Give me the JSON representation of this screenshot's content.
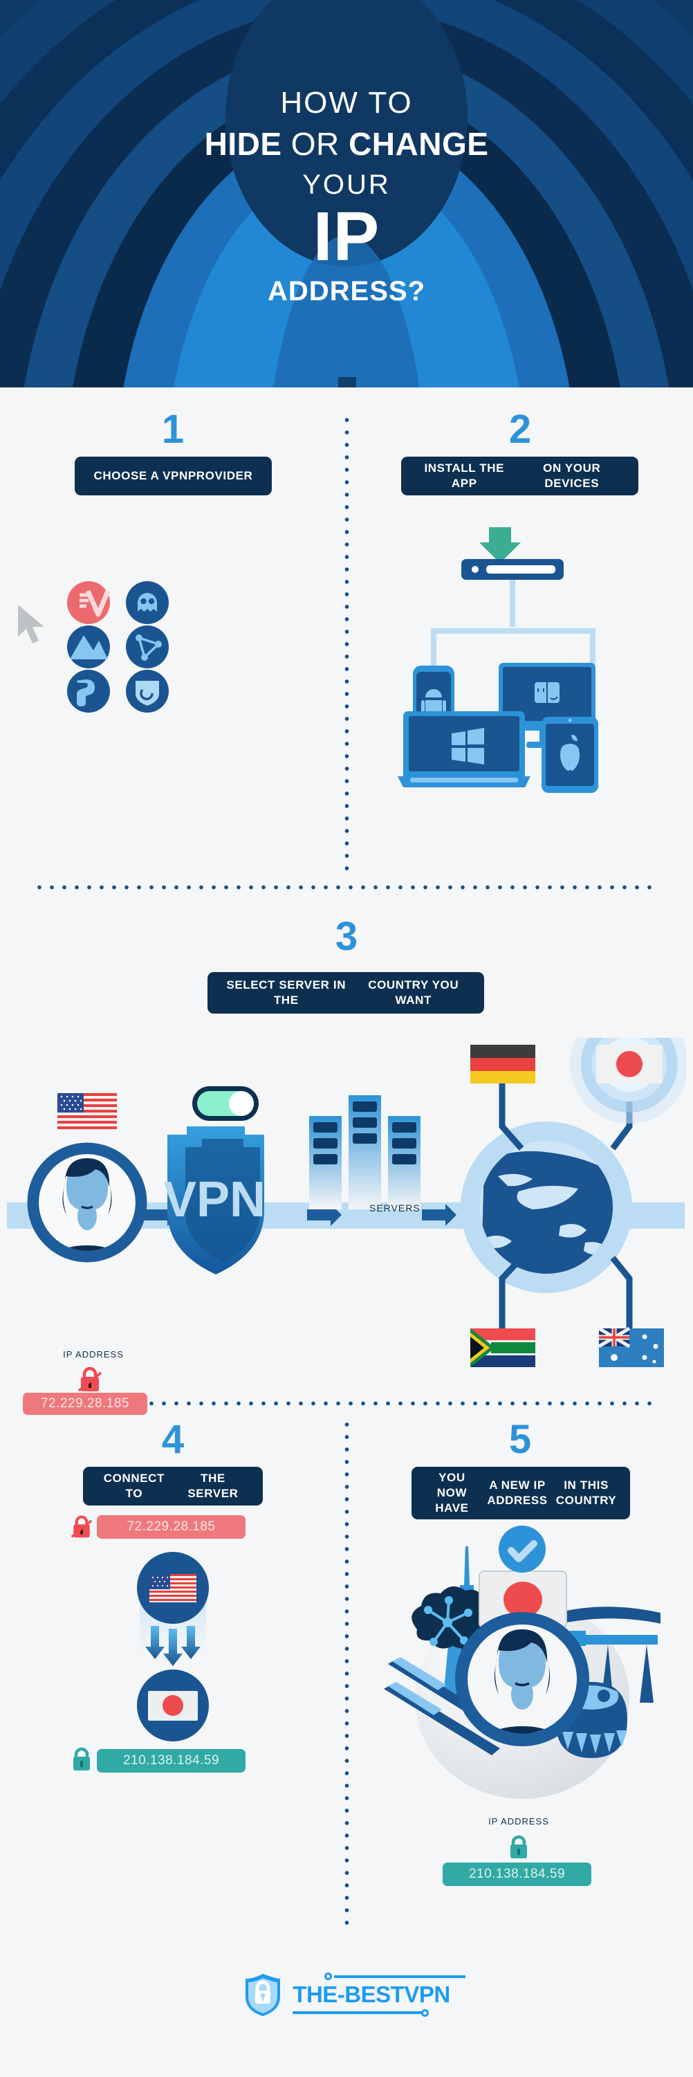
{
  "header": {
    "line1": "HOW TO",
    "line2_bold1": "HIDE",
    "line2_light": "OR",
    "line2_bold2": "CHANGE",
    "line3": "YOUR",
    "line4": "IP",
    "line5": "ADDRESS?",
    "bg_color": "#0d3a66",
    "accent_color": "#2d93d8"
  },
  "steps": [
    {
      "number": "1",
      "label": "CHOOSE A VPN\nPROVIDER",
      "providers": [
        {
          "name": "expressvpn-icon",
          "color": "#ec6a6e",
          "selected": true
        },
        {
          "name": "cyberghost-icon",
          "color": "#1a5591",
          "selected": false
        },
        {
          "name": "nordvpn-icon",
          "color": "#1a5591",
          "selected": false
        },
        {
          "name": "protonvpn-icon",
          "color": "#1a5591",
          "selected": false
        },
        {
          "name": "surfshark-icon",
          "color": "#1a5591",
          "selected": false
        },
        {
          "name": "hotspotshield-icon",
          "color": "#1a5591",
          "selected": false
        }
      ],
      "cursor": "mouse-cursor-icon"
    },
    {
      "number": "2",
      "label": "INSTALL THE APP\nON YOUR DEVICES",
      "download_arrow_color": "#3aad93",
      "devices": [
        "android-phone",
        "mac-monitor",
        "windows-laptop",
        "apple-tablet"
      ]
    },
    {
      "number": "3",
      "label": "SELECT SERVER IN THE\nCOUNTRY YOU WANT",
      "ip_label": "IP ADDRESS",
      "ip_value": "72.229.28.185",
      "ip_status": "unlocked",
      "user_flag": "us-flag",
      "vpn_text": "VPN",
      "toggle_state": "on",
      "servers_label": "SERVERS",
      "globe_flags": [
        {
          "name": "germany-flag",
          "position": "top-left"
        },
        {
          "name": "japan-flag",
          "position": "top-right",
          "highlighted": true
        },
        {
          "name": "south-africa-flag",
          "position": "bottom-left"
        },
        {
          "name": "australia-flag",
          "position": "bottom-right"
        }
      ]
    },
    {
      "number": "4",
      "label": "CONNECT TO\nTHE SERVER",
      "old_ip": "72.229.28.185",
      "old_ip_status": "unlocked",
      "new_ip": "210.138.184.59",
      "new_ip_status": "locked",
      "from_flag": "us-flag",
      "to_flag": "japan-flag"
    },
    {
      "number": "5",
      "label": "YOU NOW HAVE\nA NEW IP ADDRESS\nIN THIS COUNTRY",
      "ip_label": "IP ADDRESS",
      "ip_value": "210.138.184.59",
      "ip_status": "locked",
      "flag": "japan-flag",
      "check": "verified-check-icon",
      "landmarks": [
        "tokyo-tower",
        "chopsticks",
        "cherry-blossom",
        "torii-gate",
        "daruma-doll"
      ]
    }
  ],
  "footer": {
    "brand": "THE-BESTVPN",
    "brand_color": "#1e9bf0",
    "logo": "shield-lock-icon"
  },
  "colors": {
    "page_bg": "#f5f6f7",
    "dark_navy": "#0d3050",
    "blue": "#2d93d8",
    "deep_blue": "#14508c",
    "light_blue": "#bcdcf4",
    "red": "#ef787c",
    "teal": "#31a9a4",
    "green": "#3aad93"
  }
}
